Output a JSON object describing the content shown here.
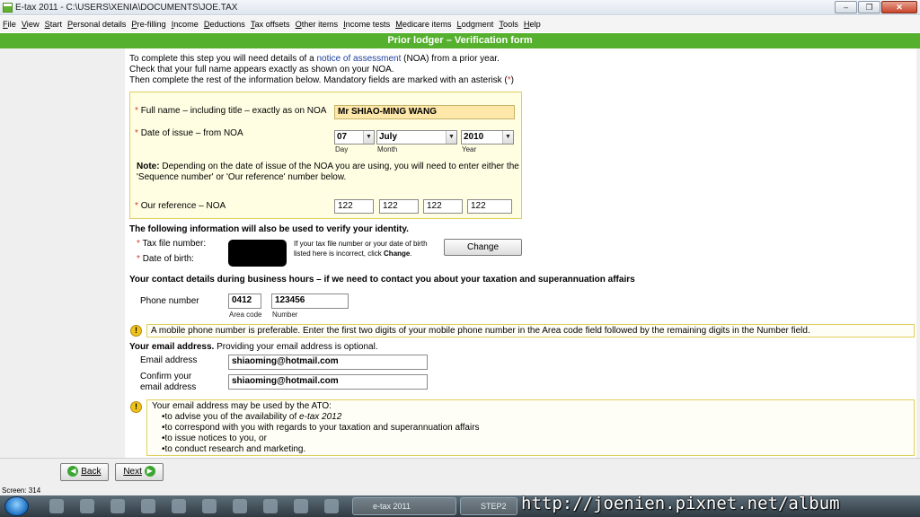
{
  "window": {
    "title": "E-tax 2011 - C:\\USERS\\XENIA\\DOCUMENTS\\JOE.TAX",
    "minimize": "–",
    "maximize": "❐",
    "close": "✕"
  },
  "menu": [
    "File",
    "View",
    "Start",
    "Personal details",
    "Pre-filling",
    "Income",
    "Deductions",
    "Tax offsets",
    "Other items",
    "Income tests",
    "Medicare items",
    "Lodgment",
    "Tools",
    "Help"
  ],
  "header": {
    "title": "Prior lodger – Verification form"
  },
  "intro": {
    "line1_a": "To complete this step you will need details of a ",
    "line1_link": "notice of assessment",
    "line1_b": " (NOA) from a prior year.",
    "line2": "Check that your full name appears exactly as shown on your NOA.",
    "line3_a": "Then complete the rest of the information below. Mandatory fields are marked with an asterisk (",
    "line3_star": "*",
    "line3_b": ")"
  },
  "noa": {
    "fullname_label": "Full name – including title – exactly as on NOA",
    "fullname_value": "Mr SHIAO-MING WANG",
    "date_label": "Date of issue – from NOA",
    "day_value": "07",
    "month_value": "July",
    "year_value": "2010",
    "day_caption": "Day",
    "month_caption": "Month",
    "year_caption": "Year",
    "note_bold": "Note:",
    "note_text": " Depending on the date of issue of the NOA you are using, you will need to enter either the",
    "note_text2": "'Sequence number' or 'Our reference' number below.",
    "ref_label": "Our reference – NOA",
    "ref_values": [
      "122",
      "122",
      "122",
      "122"
    ]
  },
  "identity": {
    "heading": "The following information will also be used to verify your identity.",
    "tfn_label": "Tax file number:",
    "dob_label": "Date of birth:",
    "help_line1": "If your tax file number or your date of birth",
    "help_line2a": "listed here is incorrect, click ",
    "help_line2b": "Change",
    "help_line2c": ".",
    "change_button": "Change"
  },
  "contact": {
    "heading": "Your contact details during business hours – if we need to contact you about your taxation and superannuation affairs",
    "phone_label": "Phone number",
    "area_value": "0412",
    "number_value": "123456",
    "area_caption": "Area code",
    "number_caption": "Number",
    "mobile_note": "A mobile phone number is preferable. Enter the first two digits of your mobile phone number in the Area code field followed by the remaining digits in the Number field."
  },
  "email": {
    "heading_bold": "Your email address.",
    "heading_rest": " Providing your email address is optional.",
    "email_label": "Email address",
    "email_value": "shiaoming@hotmail.com",
    "confirm_label1": "Confirm your",
    "confirm_label2": "email address",
    "confirm_value": "shiaoming@hotmail.com",
    "notice_title": "Your email address may be used by the ATO:",
    "notice_items": [
      "•to advise you of the availability of ",
      "•to correspond with you with regards to your taxation and superannuation affairs",
      "•to issue notices to you, or",
      "•to conduct research and marketing."
    ],
    "notice_item1_italic": "e-tax 2012"
  },
  "nav": {
    "back": "Back",
    "next": "Next"
  },
  "status": {
    "text": "Screen: 314"
  },
  "taskbar": {
    "item1": "e-tax 2011",
    "item2": "STEP2"
  },
  "watermark": "http://joenien.pixnet.net/album",
  "colors": {
    "green": "#55b02d",
    "required": "#d23a2a",
    "link": "#1d3f9a",
    "notice_border": "#e0cf5b"
  }
}
